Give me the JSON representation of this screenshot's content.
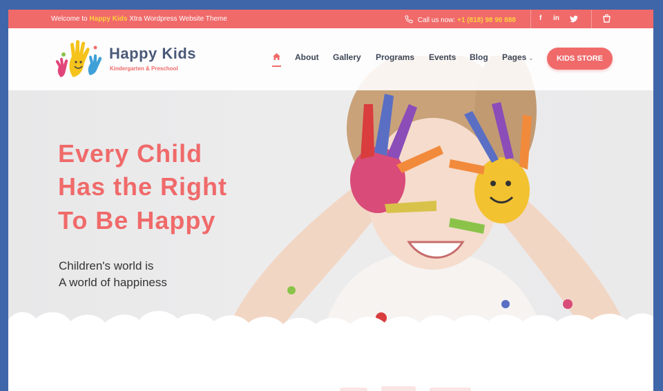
{
  "topbar": {
    "welcome_prefix": "Welcome to",
    "welcome_brand": "Happy Kids",
    "welcome_suffix": "Xtra Wordpress Website Theme",
    "call_label": "Call us now:",
    "phone": "+1 (818) 98 90 888",
    "social": [
      "f",
      "in"
    ]
  },
  "header": {
    "logo_title": "Happy Kids",
    "logo_subtitle": "Kindergarten & Preschool",
    "nav": [
      "About",
      "Gallery",
      "Programs",
      "Events",
      "Blog",
      "Pages"
    ],
    "store_button": "KIDS STORE"
  },
  "hero": {
    "headline": [
      "Every Child",
      "Has the Right",
      "To Be Happy"
    ],
    "subline": [
      "Children's world is",
      "A world of happiness"
    ]
  },
  "colors": {
    "brand": "#f06a6a",
    "highlight": "#ffd23f",
    "nav_text": "#3d4656",
    "page_frame": "#3f66a8"
  },
  "icons": [
    "phone-icon",
    "facebook-icon",
    "linkedin-icon",
    "twitter-icon",
    "cart-icon",
    "home-icon",
    "hands-logo-icon"
  ]
}
